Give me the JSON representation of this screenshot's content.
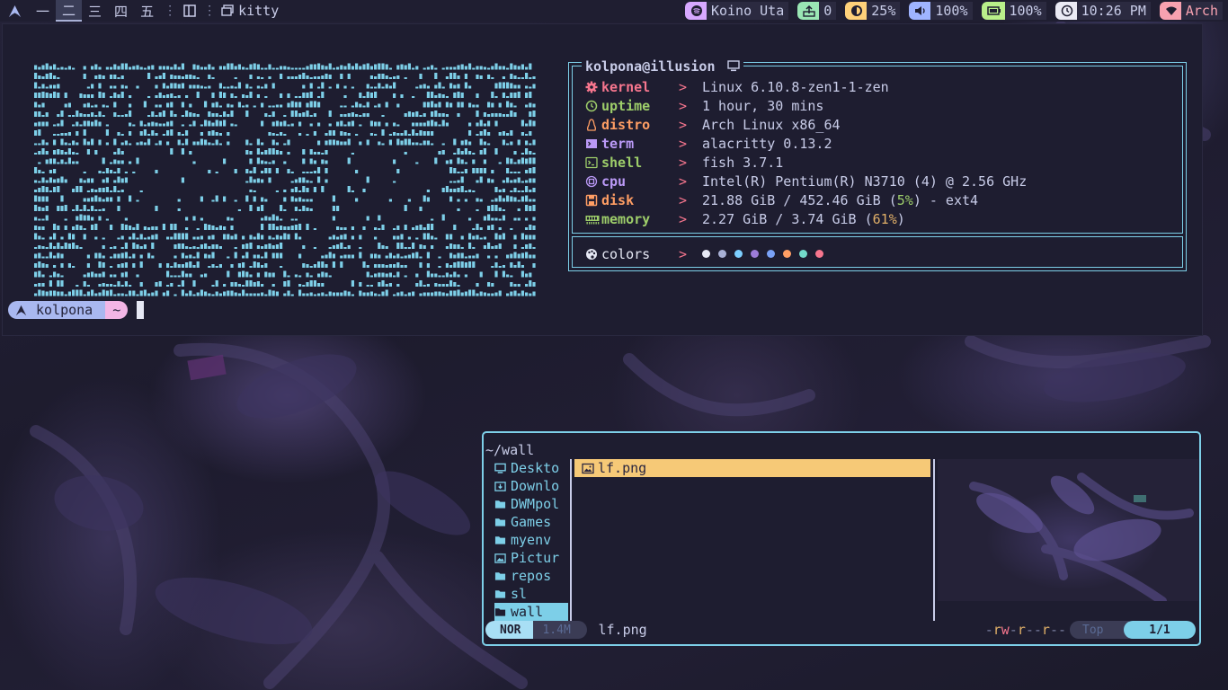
{
  "topbar": {
    "workspaces": [
      "一",
      "二",
      "三",
      "四",
      "五"
    ],
    "active_workspace": "二",
    "window_title": "kitty",
    "widgets": [
      {
        "name": "spotify",
        "icon": "spotify-icon",
        "value": "Koino Uta",
        "color": "#d7a8ff"
      },
      {
        "name": "updates",
        "icon": "upload-icon",
        "value": "0",
        "color": "#9ae6b4"
      },
      {
        "name": "brightness",
        "icon": "brightness-icon",
        "value": "25%",
        "color": "#ffd17a"
      },
      {
        "name": "volume",
        "icon": "volume-icon",
        "value": "100%",
        "color": "#9fb4ff"
      },
      {
        "name": "battery",
        "icon": "battery-icon",
        "value": "100%",
        "color": "#b9f08a"
      },
      {
        "name": "clock",
        "icon": "clock-icon",
        "value": "10:26 PM",
        "color": "#eaeaf4"
      },
      {
        "name": "distro",
        "icon": "wifi-icon",
        "value": "Arch",
        "color": "#f7a1b0"
      }
    ]
  },
  "fastfetch": {
    "header": "kolpona@illusion",
    "rows": [
      {
        "key": "kernel",
        "value": "Linux 6.10.8-zen1-1-zen",
        "color": "#f7768e",
        "icon": "gear-icon"
      },
      {
        "key": "uptime",
        "value": "1 hour, 30 mins",
        "color": "#9ece6a",
        "icon": "clock-icon"
      },
      {
        "key": "distro",
        "value": "Arch Linux x86_64",
        "color": "#ff9e64",
        "icon": "penguin-icon"
      },
      {
        "key": "term",
        "value": "alacritty 0.13.2",
        "color": "#bb9af7",
        "icon": "terminal-icon"
      },
      {
        "key": "shell",
        "value": "fish 3.7.1",
        "color": "#9ece6a",
        "icon": "prompt-icon"
      },
      {
        "key": "cpu",
        "value": "Intel(R) Pentium(R)  N3710 (4) @ 2.56 GHz",
        "color": "#bb9af7",
        "icon": "cpu-icon"
      },
      {
        "key": "disk",
        "value_pre": "21.88 GiB / 452.46 GiB (",
        "value_pct": "5%",
        "value_post": ") - ext4",
        "color": "#ff9e64",
        "pct_color": "#9ece6a",
        "icon": "disk-icon"
      },
      {
        "key": "memory",
        "value_pre": "2.27 GiB / 3.74 GiB (",
        "value_pct": "61%",
        "value_post": ")",
        "color": "#9ece6a",
        "pct_color": "#e0af68",
        "icon": "memory-icon"
      }
    ],
    "colors_label": "colors",
    "palette": [
      "#e6e8f4",
      "#a9b1d6",
      "#7dcfff",
      "#9d7cd8",
      "#7aa2f7",
      "#ff9e64",
      "#73daca",
      "#f7768e"
    ],
    "arrow": ">"
  },
  "prompt": {
    "user": "kolpona",
    "dir": "~"
  },
  "lf": {
    "path": "~/wall",
    "parent_items": [
      {
        "label": "Deskto",
        "icon": "desktop-icon"
      },
      {
        "label": "Downlo",
        "icon": "download-folder-icon"
      },
      {
        "label": "DWMpol",
        "icon": "folder-icon"
      },
      {
        "label": "Games",
        "icon": "folder-icon"
      },
      {
        "label": "myenv",
        "icon": "folder-icon"
      },
      {
        "label": "Pictur",
        "icon": "pictures-folder-icon"
      },
      {
        "label": "repos",
        "icon": "folder-icon"
      },
      {
        "label": "sl",
        "icon": "folder-icon"
      },
      {
        "label": "wall",
        "icon": "folder-icon",
        "selected": true
      }
    ],
    "files": [
      {
        "label": "lf.png",
        "icon": "image-file-icon",
        "selected": true
      }
    ],
    "status": {
      "mode": "NOR",
      "size": "1.4M",
      "file": "lf.png",
      "perm": "-rw-r--r--",
      "scroll": "Top",
      "position": "1/1"
    }
  }
}
